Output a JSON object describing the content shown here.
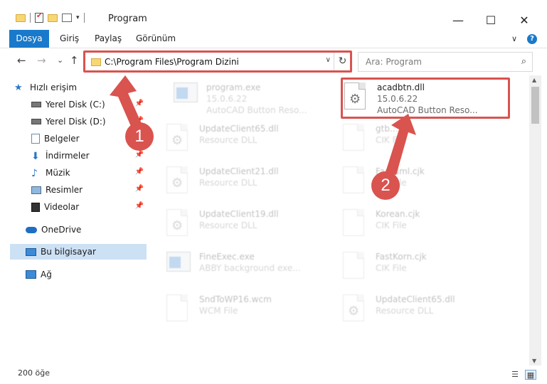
{
  "window": {
    "title": "Program",
    "minimize": "—",
    "maximize": "☐",
    "close": "✕"
  },
  "ribbon": {
    "tabs": [
      "Dosya",
      "Giriş",
      "Paylaş",
      "Görünüm"
    ],
    "expand": "∨",
    "help": "?"
  },
  "nav": {
    "back": "←",
    "forward": "→",
    "recent": "⌄",
    "up": "↑",
    "address": "C:\\Program Files\\Program Dizini",
    "address_caret": "∨",
    "refresh": "↻",
    "search_placeholder": "Ara: Program",
    "search_icon": "⌕"
  },
  "sidebar": {
    "items": [
      {
        "label": "Hızlı erişim",
        "icon": "star-icon",
        "pinned": false
      },
      {
        "label": "Yerel Disk (C:)",
        "icon": "drive-icon",
        "pinned": true
      },
      {
        "label": "Yerel Disk (D:)",
        "icon": "drive-icon",
        "pinned": true
      },
      {
        "label": "Belgeler",
        "icon": "documents-icon",
        "pinned": false
      },
      {
        "label": "İndirmeler",
        "icon": "download-icon",
        "pinned": true
      },
      {
        "label": "Müzik",
        "icon": "music-icon",
        "pinned": true
      },
      {
        "label": "Resimler",
        "icon": "pictures-icon",
        "pinned": true
      },
      {
        "label": "Videolar",
        "icon": "video-icon",
        "pinned": true
      },
      {
        "label": "OneDrive",
        "icon": "cloud-icon",
        "pinned": false
      },
      {
        "label": "Bu bilgisayar",
        "icon": "computer-icon",
        "pinned": false
      },
      {
        "label": "Ağ",
        "icon": "network-icon",
        "pinned": false
      }
    ]
  },
  "files": [
    {
      "name": "program.exe",
      "line2": "15.0.6.22",
      "line3": "AutoCAD Button Reso...",
      "type": "app",
      "faded": true
    },
    {
      "name": "acadbtn.dll",
      "line2": "15.0.6.22",
      "line3": "AutoCAD Button Reso...",
      "type": "dll",
      "faded": false
    },
    {
      "name": "UpdateClient65.dll",
      "line2": "Resource DLL",
      "line3": "",
      "type": "dll",
      "faded": true
    },
    {
      "name": "gtb...",
      "line2": "CIK File",
      "line3": "",
      "type": "doc",
      "faded": true
    },
    {
      "name": "UpdateClient21.dll",
      "line2": "Resource DLL",
      "line3": "",
      "type": "dll",
      "faded": true
    },
    {
      "name": "FastNml.cjk",
      "line2": "CIK File",
      "line3": "",
      "type": "doc",
      "faded": true
    },
    {
      "name": "UpdateClient19.dll",
      "line2": "Resource DLL",
      "line3": "",
      "type": "dll",
      "faded": true
    },
    {
      "name": "Korean.cjk",
      "line2": "CIK File",
      "line3": "",
      "type": "doc",
      "faded": true
    },
    {
      "name": "FineExec.exe",
      "line2": "ABBY background exe...",
      "line3": "",
      "type": "app",
      "faded": true
    },
    {
      "name": "FastKorn.cjk",
      "line2": "CIK File",
      "line3": "",
      "type": "doc",
      "faded": true
    },
    {
      "name": "SndToWP16.wcm",
      "line2": "WCM File",
      "line3": "",
      "type": "doc",
      "faded": true
    },
    {
      "name": "UpdateClient65.dll",
      "line2": "Resource DLL",
      "line3": "",
      "type": "dll",
      "faded": true
    }
  ],
  "status": {
    "count": "200 öğe"
  },
  "callouts": [
    "1",
    "2"
  ],
  "colors": {
    "accent": "#1979ca",
    "highlight": "#d9534f",
    "selected": "#cde1f5"
  }
}
